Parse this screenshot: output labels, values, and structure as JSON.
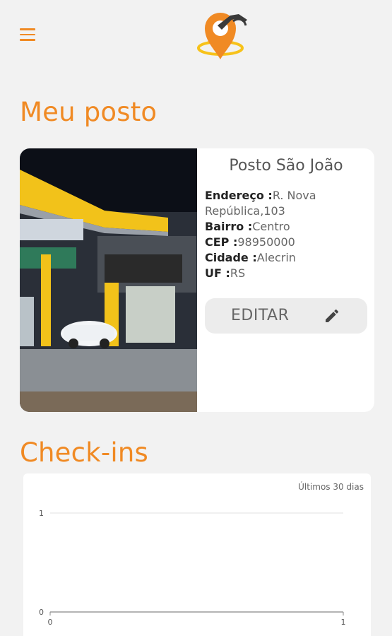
{
  "app": {
    "colors": {
      "accent": "#f08a24",
      "background": "#f2f2f2",
      "card": "#ffffff"
    },
    "icons": {
      "menu": "hamburger-icon",
      "logo": "fuel-pump-location-pin-logo",
      "edit": "pencil-icon"
    }
  },
  "header": {
    "title": "Meu posto"
  },
  "station": {
    "name": "Posto São João",
    "fields": [
      {
        "label": "Endereço :",
        "value": "R. Nova República,103"
      },
      {
        "label": "Bairro :",
        "value": "Centro"
      },
      {
        "label": "CEP :",
        "value": "98950000"
      },
      {
        "label": "Cidade :",
        "value": "Alecrin"
      },
      {
        "label": "UF :",
        "value": "RS"
      }
    ],
    "edit_label": "EDITAR"
  },
  "checkins": {
    "title": "Check-ins",
    "period_label": "Últimos 30 dias"
  },
  "chart_data": {
    "type": "line",
    "x": [
      0,
      1
    ],
    "series": [
      {
        "values": []
      }
    ],
    "xlim": [
      0,
      1
    ],
    "ylim": [
      0,
      1
    ],
    "x_ticks": [
      "0",
      "1"
    ],
    "y_ticks": [
      "0",
      "1"
    ],
    "grid": true
  }
}
